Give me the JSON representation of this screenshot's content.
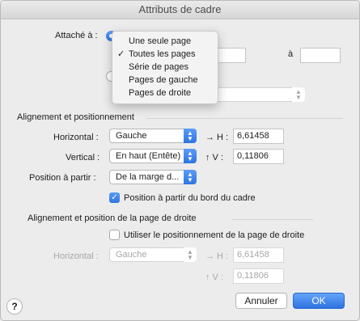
{
  "window": {
    "title": "Attributs de cadre"
  },
  "anchor": {
    "label": "Attaché à :",
    "menu_items": [
      {
        "label": "Une seule page",
        "checked": false
      },
      {
        "label": "Toutes les pages",
        "checked": true
      },
      {
        "label": "Série de pages",
        "checked": false
      },
      {
        "label": "Pages de gauche",
        "checked": false
      },
      {
        "label": "Pages de droite",
        "checked": false
      }
    ],
    "check_mark": "✓",
    "range_to_label": "à"
  },
  "alignment": {
    "section_title": "Alignement et positionnement",
    "horizontal_label": "Horizontal :",
    "horizontal_value": "Gauche",
    "h_label": "→ H :",
    "h_value": "6,61458",
    "vertical_label": "Vertical :",
    "vertical_value": "En haut (Entête)",
    "v_label": "↑ V :",
    "v_value": "0,11806",
    "position_from_label": "Position à partir :",
    "position_from_value": "De la marge d...",
    "frame_edge_checkbox_label": "Position à partir du bord du cadre",
    "frame_edge_checked": true
  },
  "right_page": {
    "section_title": "Alignement et position de la page de droite",
    "use_right_checkbox_label": "Utiliser le positionnement de la page de droite",
    "use_right_checked": false,
    "horizontal_label": "Horizontal :",
    "horizontal_value": "Gauche",
    "h_label": "→ H :",
    "h_value": "6,61458",
    "v_label": "↑ V :",
    "v_value": "0,11806"
  },
  "buttons": {
    "help": "?",
    "cancel": "Annuler",
    "ok": "OK"
  },
  "icons": {
    "popup_arrows": "up-down-chevron-icon"
  },
  "colors": {
    "accent": "#3478f6",
    "background": "#ececec"
  }
}
